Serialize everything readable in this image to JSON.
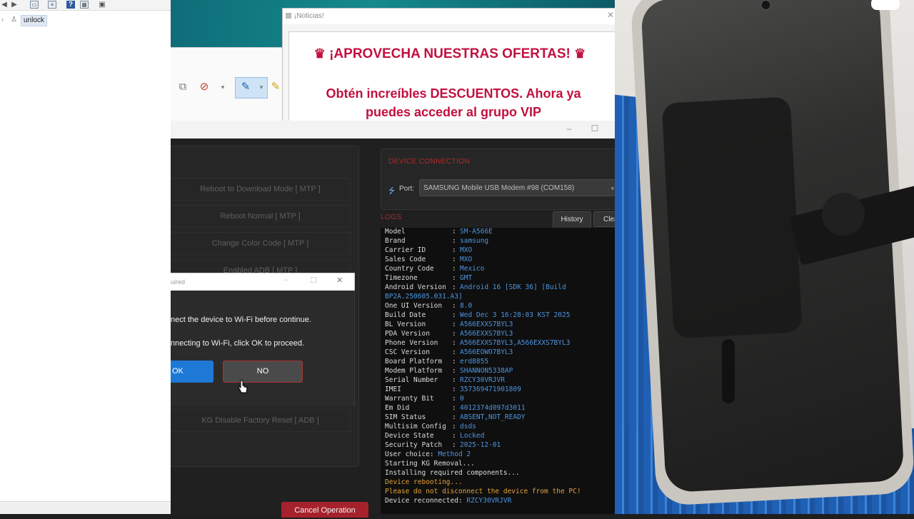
{
  "explorer": {
    "toolbar_icons": [
      "back-arrow-icon",
      "forward-arrow-icon",
      "window-icon",
      "properties-icon",
      "help-icon",
      "list-icon",
      "monitor-icon"
    ],
    "tree_item": "unlock"
  },
  "notice": {
    "window_title": "¡Noticias!",
    "headline": "¡APROVECHA NUESTRAS OFERTAS!",
    "body": "Obtén increíbles DESCUENTOS. Ahora ya puedes acceder al grupo VIP",
    "accent_color": "#c2103f"
  },
  "app": {
    "operations": [
      "Reboot to Download Mode [ MTP ]",
      "Reboot Normal [ MTP ]",
      "Change Color Code [ MTP ]",
      "Enabled ADB [ MTP ]",
      "KG Disable Factory Reset [ ADB ]"
    ],
    "cancel_label": "Cancel Operation",
    "device_connection": {
      "title": "DEVICE CONNECTION",
      "port_label": "Port:",
      "port_value": "SAMSUNG Mobile USB Modem #98 (COM158)"
    },
    "logs": {
      "title": "LOGS",
      "history_label": "History",
      "clear_label": "Clea",
      "entries": [
        {
          "k": "Model",
          "v": "SM-A566E"
        },
        {
          "k": "Brand",
          "v": "samsung"
        },
        {
          "k": "Carrier ID",
          "v": "MXO"
        },
        {
          "k": "Sales Code",
          "v": "MXO"
        },
        {
          "k": "Country Code",
          "v": "Mexico"
        },
        {
          "k": "Timezone",
          "v": "GMT"
        },
        {
          "k": "Android Version",
          "v": "Android 16 [SDK 36] [Build"
        },
        {
          "k": "",
          "v": "BP2A.250605.031.A3]",
          "cont": true
        },
        {
          "k": "One UI Version",
          "v": "8.0"
        },
        {
          "k": "Build Date",
          "v": "Wed Dec  3 16:28:03 KST 2025"
        },
        {
          "k": "BL Version",
          "v": "A566EXXS7BYL3"
        },
        {
          "k": "PDA Version",
          "v": "A566EXXS7BYL3"
        },
        {
          "k": "Phone Version",
          "v": "A566EXXS7BYL3,A566EXXS7BYL3"
        },
        {
          "k": "CSC Version",
          "v": "A566EOWO7BYL3"
        },
        {
          "k": "Board Platform",
          "v": "erd8855"
        },
        {
          "k": "Modem Platform",
          "v": "SHANNON5338AP"
        },
        {
          "k": "Serial Number",
          "v": "RZCY30VRJVR"
        },
        {
          "k": "IMEI",
          "v": "357369471901809"
        },
        {
          "k": "Warranty Bit",
          "v": "0"
        },
        {
          "k": "Em Did",
          "v": "4012374d097d3011"
        },
        {
          "k": "SIM Status",
          "v": "ABSENT,NOT_READY"
        },
        {
          "k": "Multisim Config",
          "v": "dsds"
        },
        {
          "k": "Device State",
          "v": "Locked"
        },
        {
          "k": "Security Patch",
          "v": "2025-12-01"
        }
      ],
      "messages": [
        {
          "prefix": "User choice: ",
          "value": "Method 2",
          "style": "mixed"
        },
        {
          "text": "Starting KG Removal...",
          "style": "plain"
        },
        {
          "text": "Installing required components...",
          "style": "plain"
        },
        {
          "text": "Device rebooting...",
          "style": "warn"
        },
        {
          "text": "Please do not disconnect the device from the PC!",
          "style": "warn"
        },
        {
          "prefix": "Device reconnected: ",
          "value": "RZCY30VRJVR",
          "style": "mixed"
        }
      ]
    }
  },
  "dialog": {
    "title_fragment": "uired",
    "message_1": "nect the device to Wi-Fi before continue.",
    "message_2": "nnecting to Wi-Fi, click OK to proceed.",
    "ok_label": "OK",
    "no_label": "NO"
  },
  "colors": {
    "log_value": "#4d94e0",
    "log_warning": "#e3a33a",
    "danger": "#a5222c",
    "primary": "#1e78d6"
  }
}
